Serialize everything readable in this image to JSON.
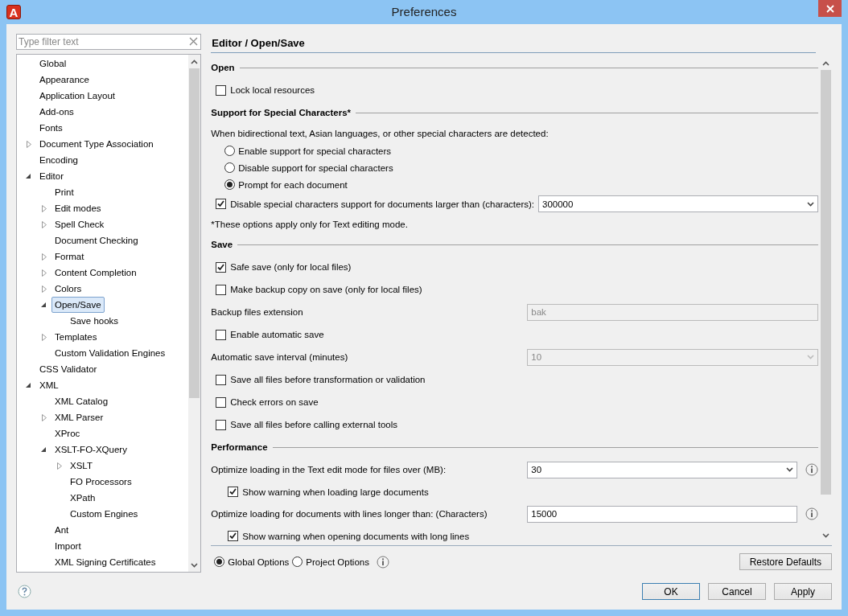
{
  "window": {
    "title": "Preferences",
    "logo_letter": "A"
  },
  "filter": {
    "placeholder": "Type filter text"
  },
  "tree": [
    {
      "label": "Global",
      "expandable": false,
      "selected": false
    },
    {
      "label": "Appearance",
      "expandable": false,
      "selected": false
    },
    {
      "label": "Application Layout",
      "expandable": false,
      "selected": false
    },
    {
      "label": "Add-ons",
      "expandable": false,
      "selected": false
    },
    {
      "label": "Fonts",
      "expandable": false,
      "selected": false
    },
    {
      "label": "Document Type Association",
      "expandable": true,
      "expanded": false,
      "selected": false
    },
    {
      "label": "Encoding",
      "expandable": false,
      "selected": false
    },
    {
      "label": "Editor",
      "expandable": true,
      "expanded": true,
      "selected": false,
      "children": [
        {
          "label": "Print",
          "expandable": false,
          "selected": false
        },
        {
          "label": "Edit modes",
          "expandable": true,
          "expanded": false,
          "selected": false
        },
        {
          "label": "Spell Check",
          "expandable": true,
          "expanded": false,
          "selected": false
        },
        {
          "label": "Document Checking",
          "expandable": false,
          "selected": false
        },
        {
          "label": "Format",
          "expandable": true,
          "expanded": false,
          "selected": false
        },
        {
          "label": "Content Completion",
          "expandable": true,
          "expanded": false,
          "selected": false
        },
        {
          "label": "Colors",
          "expandable": true,
          "expanded": false,
          "selected": false
        },
        {
          "label": "Open/Save",
          "expandable": true,
          "expanded": true,
          "selected": true,
          "children": [
            {
              "label": "Save hooks",
              "expandable": false,
              "selected": false
            }
          ]
        },
        {
          "label": "Templates",
          "expandable": true,
          "expanded": false,
          "selected": false
        },
        {
          "label": "Custom Validation Engines",
          "expandable": false,
          "selected": false
        }
      ]
    },
    {
      "label": "CSS Validator",
      "expandable": false,
      "selected": false
    },
    {
      "label": "XML",
      "expandable": true,
      "expanded": true,
      "selected": false,
      "children": [
        {
          "label": "XML Catalog",
          "expandable": false,
          "selected": false
        },
        {
          "label": "XML Parser",
          "expandable": true,
          "expanded": false,
          "selected": false
        },
        {
          "label": "XProc",
          "expandable": false,
          "selected": false
        },
        {
          "label": "XSLT-FO-XQuery",
          "expandable": true,
          "expanded": true,
          "selected": false,
          "children": [
            {
              "label": "XSLT",
              "expandable": true,
              "expanded": false,
              "selected": false
            },
            {
              "label": "FO Processors",
              "expandable": false,
              "selected": false
            },
            {
              "label": "XPath",
              "expandable": false,
              "selected": false
            },
            {
              "label": "Custom Engines",
              "expandable": false,
              "selected": false
            }
          ]
        },
        {
          "label": "Ant",
          "expandable": false,
          "selected": false
        },
        {
          "label": "Import",
          "expandable": false,
          "selected": false
        },
        {
          "label": "XML Signing Certificates",
          "expandable": false,
          "selected": false
        }
      ]
    }
  ],
  "page_title": "Editor / Open/Save",
  "content": [
    {
      "kind": "section",
      "label": "Open"
    },
    {
      "kind": "checkbox",
      "label": "Lock local resources",
      "checked": false
    },
    {
      "kind": "section",
      "label": "Support for Special Characters*"
    },
    {
      "kind": "text",
      "label": "When bidirectional text, Asian languages, or other special characters are detected:"
    },
    {
      "kind": "radio",
      "label": "Enable support for special characters",
      "selected": false
    },
    {
      "kind": "radio",
      "label": "Disable support for special characters",
      "selected": false
    },
    {
      "kind": "radio",
      "label": "Prompt for each document",
      "selected": true
    },
    {
      "kind": "checkbox-select",
      "label": "Disable special characters support for documents larger than (characters):",
      "checked": true,
      "value": "300000"
    },
    {
      "kind": "text",
      "label": "*These options apply only for Text editing mode."
    },
    {
      "kind": "section",
      "label": "Save"
    },
    {
      "kind": "checkbox",
      "label": "Safe save (only for local files)",
      "checked": true
    },
    {
      "kind": "checkbox",
      "label": "Make backup copy on save (only for local files)",
      "checked": false
    },
    {
      "kind": "field",
      "label": "Backup files extension",
      "value": "bak",
      "disabled": true,
      "info": false
    },
    {
      "kind": "checkbox",
      "label": "Enable automatic save",
      "checked": false
    },
    {
      "kind": "select",
      "label": "Automatic save interval (minutes)",
      "value": "10",
      "disabled": true,
      "info": false
    },
    {
      "kind": "checkbox",
      "label": "Save all files before transformation or validation",
      "checked": false
    },
    {
      "kind": "checkbox",
      "label": "Check errors on save",
      "checked": false
    },
    {
      "kind": "checkbox",
      "label": "Save all files before calling external tools",
      "checked": false
    },
    {
      "kind": "section",
      "label": "Performance"
    },
    {
      "kind": "select",
      "label": "Optimize loading in the Text edit mode for files over (MB):",
      "value": "30",
      "disabled": false,
      "info": true
    },
    {
      "kind": "sub-checkbox",
      "label": "Show warning when loading large documents",
      "checked": true
    },
    {
      "kind": "field",
      "label": "Optimize loading for documents with lines longer than: (Characters)",
      "value": "15000",
      "disabled": false,
      "info": true
    },
    {
      "kind": "sub-checkbox",
      "label": "Show warning when opening documents with long lines",
      "checked": true
    }
  ],
  "scope_options": [
    {
      "label": "Global Options",
      "selected": true
    },
    {
      "label": "Project Options",
      "selected": false
    }
  ],
  "restore_button": "Restore Defaults",
  "buttons": [
    "OK",
    "Cancel",
    "Apply"
  ]
}
